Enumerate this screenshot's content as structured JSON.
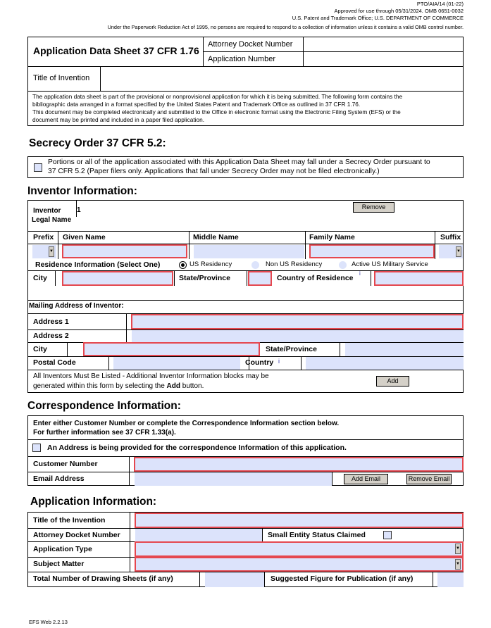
{
  "header": {
    "form_id": "PTO/AIA/14 (01-22)",
    "approved": "Approved for use through 05/31/2024.  OMB 0651-0032",
    "office": "U.S. Patent and Trademark Office; U.S. DEPARTMENT OF COMMERCE",
    "paperwork": "Under the Paperwork Reduction Act of 1995, no persons are required to respond to a collection of information unless it contains a valid OMB control number."
  },
  "title_block": {
    "title": "Application Data Sheet 37 CFR 1.76",
    "attorney_docket_label": "Attorney Docket Number",
    "attorney_docket_value": "",
    "application_number_label": "Application Number",
    "application_number_value": "",
    "title_of_invention_label": "Title of Invention",
    "title_of_invention_value": "",
    "intro_line1": "The application data sheet is part of the provisional or nonprovisional application for which it is being submitted. The following form contains the",
    "intro_line2": "bibliographic data arranged in a format specified by the United States Patent and Trademark Office as outlined in 37 CFR 1.76.",
    "intro_line3": "This document may be completed electronically and submitted to the Office in electronic format using the Electronic Filing System (EFS) or the",
    "intro_line4": "document may be printed and included in a paper filed application."
  },
  "secrecy": {
    "heading": "Secrecy Order 37 CFR 5.2:",
    "line1": "Portions or all of the application associated with this Application Data Sheet may fall under a Secrecy Order pursuant to",
    "line2": "37 CFR 5.2  (Paper filers only. Applications that fall under Secrecy Order may not be filed electronically.)",
    "checked": false
  },
  "inventor": {
    "heading": "Inventor Information:",
    "inventor_label": "Inventor",
    "inventor_number": "1",
    "remove_button": "Remove",
    "legal_name_label": "Legal Name",
    "columns": {
      "prefix": "Prefix",
      "given": "Given Name",
      "middle": "Middle Name",
      "family": "Family Name",
      "suffix": "Suffix"
    },
    "values": {
      "prefix": "",
      "given": "",
      "middle": "",
      "family": "",
      "suffix": ""
    },
    "residence_label": "Residence Information (Select One)",
    "residence_options": [
      "US Residency",
      "Non US Residency",
      "Active US Military Service"
    ],
    "residence_selected": "US Residency",
    "city_label": "City",
    "state_label": "State/Province",
    "country_label": "Country of Residence",
    "info_icon": "i",
    "mailing_label": "Mailing Address of Inventor:",
    "address1_label": "Address 1",
    "address2_label": "Address 2",
    "mail_city_label": "City",
    "mail_state_label": "State/Province",
    "postal_label": "Postal Code",
    "country_short_label": "Country",
    "footer_line1": "All Inventors Must Be Listed - Additional Inventor Information blocks may be",
    "footer_line2_pre": "generated within this form by selecting the ",
    "footer_line2_bold": "Add",
    "footer_line2_post": " button.",
    "add_button": "Add"
  },
  "correspondence": {
    "heading": "Correspondence Information:",
    "note1": "Enter either Customer Number or complete the Correspondence Information section below.",
    "note2": "For further information see 37 CFR 1.33(a).",
    "address_checkbox_label": "An Address is being provided for the correspondence Information of this application.",
    "address_checked": false,
    "customer_number_label": "Customer Number",
    "customer_number_value": "",
    "email_label": "Email Address",
    "email_value": "",
    "add_email_button": "Add Email",
    "remove_email_button": "Remove Email"
  },
  "application": {
    "heading": "Application Information:",
    "title_label": "Title of the Invention",
    "docket_label": "Attorney Docket Number",
    "small_entity_label": "Small Entity Status Claimed",
    "small_entity_checked": false,
    "app_type_label": "Application Type",
    "app_type_value": "",
    "subject_label": "Subject Matter",
    "subject_value": "",
    "drawing_sheets_label": "Total Number of Drawing Sheets (if any)",
    "suggested_figure_label": "Suggested Figure for Publication (if any)"
  },
  "footer": {
    "version": "EFS Web 2.2.13"
  }
}
